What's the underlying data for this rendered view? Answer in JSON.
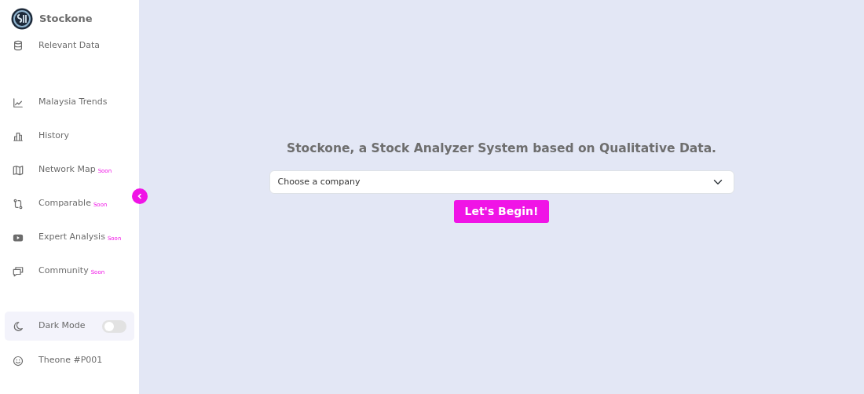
{
  "brand": {
    "name": "Stockone"
  },
  "nav_top": [
    {
      "label": "Relevant Data"
    }
  ],
  "nav": [
    {
      "label": "Malaysia Trends"
    },
    {
      "label": "History"
    },
    {
      "label": "Network Map",
      "badge": "Soon"
    },
    {
      "label": "Comparable",
      "badge": "Soon"
    },
    {
      "label": "Expert Analysis",
      "badge": "Soon"
    },
    {
      "label": "Community",
      "badge": "Soon"
    }
  ],
  "dark_mode": {
    "label": "Dark Mode",
    "on": false
  },
  "user": {
    "label": "Theone #P001"
  },
  "main": {
    "heading": "Stockone, a Stock Analyzer System based on Qualitative Data.",
    "select": {
      "value": "Choose a company"
    },
    "button": "Let's Begin!"
  }
}
